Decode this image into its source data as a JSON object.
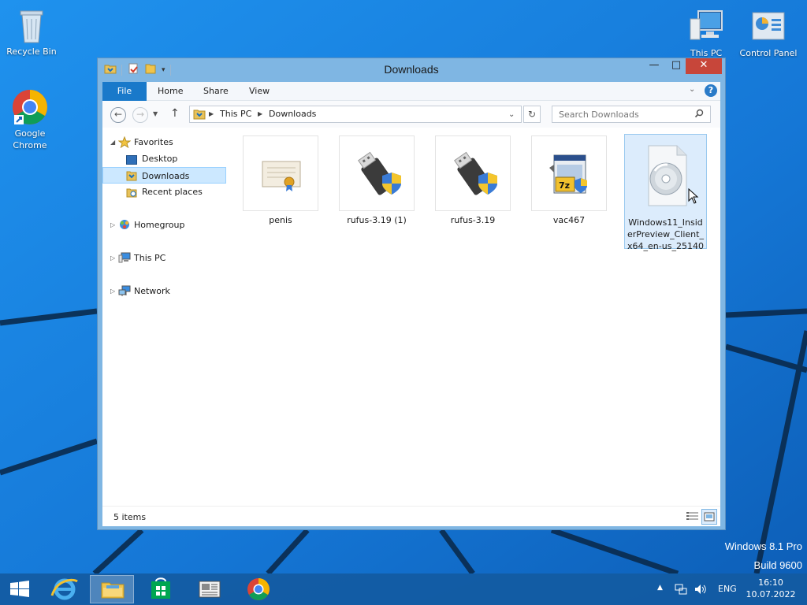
{
  "desktop": {
    "icons": [
      {
        "label": "Recycle Bin"
      },
      {
        "label": "Google Chrome"
      },
      {
        "label": "This PC"
      },
      {
        "label": "Control Panel"
      }
    ],
    "watermark": {
      "line1": "Windows 8.1 Pro",
      "line2": "Build 9600"
    }
  },
  "window": {
    "title": "Downloads",
    "ribbon_tabs": [
      "File",
      "Home",
      "Share",
      "View"
    ],
    "breadcrumb": [
      "This PC",
      "Downloads"
    ],
    "search_placeholder": "Search Downloads",
    "nav": {
      "favorites": "Favorites",
      "desktop": "Desktop",
      "downloads": "Downloads",
      "recent": "Recent places",
      "homegroup": "Homegroup",
      "thispc": "This PC",
      "network": "Network"
    },
    "files": [
      {
        "name": "penis",
        "icon": "certificate-icon"
      },
      {
        "name": "rufus-3.19 (1)",
        "icon": "usb-drive-shield-icon"
      },
      {
        "name": "rufus-3.19",
        "icon": "usb-drive-shield-icon"
      },
      {
        "name": "vac467",
        "icon": "7zip-installer-icon"
      },
      {
        "name": "Windows11_InsiderPreview_Client_x64_en-us_25140",
        "name_lines": [
          "Windows11_Insid",
          "erPreview_Client_",
          "x64_en-us_25140"
        ],
        "icon": "disc-image-icon"
      }
    ],
    "status": "5 items"
  },
  "taskbar": {
    "language": "ENG",
    "time": "16:10",
    "date": "10.07.2022"
  },
  "colors": {
    "accent": "#1979ca",
    "window_frame": "#7fb6e3",
    "close": "#c7463a",
    "selection": "#cce8ff"
  }
}
